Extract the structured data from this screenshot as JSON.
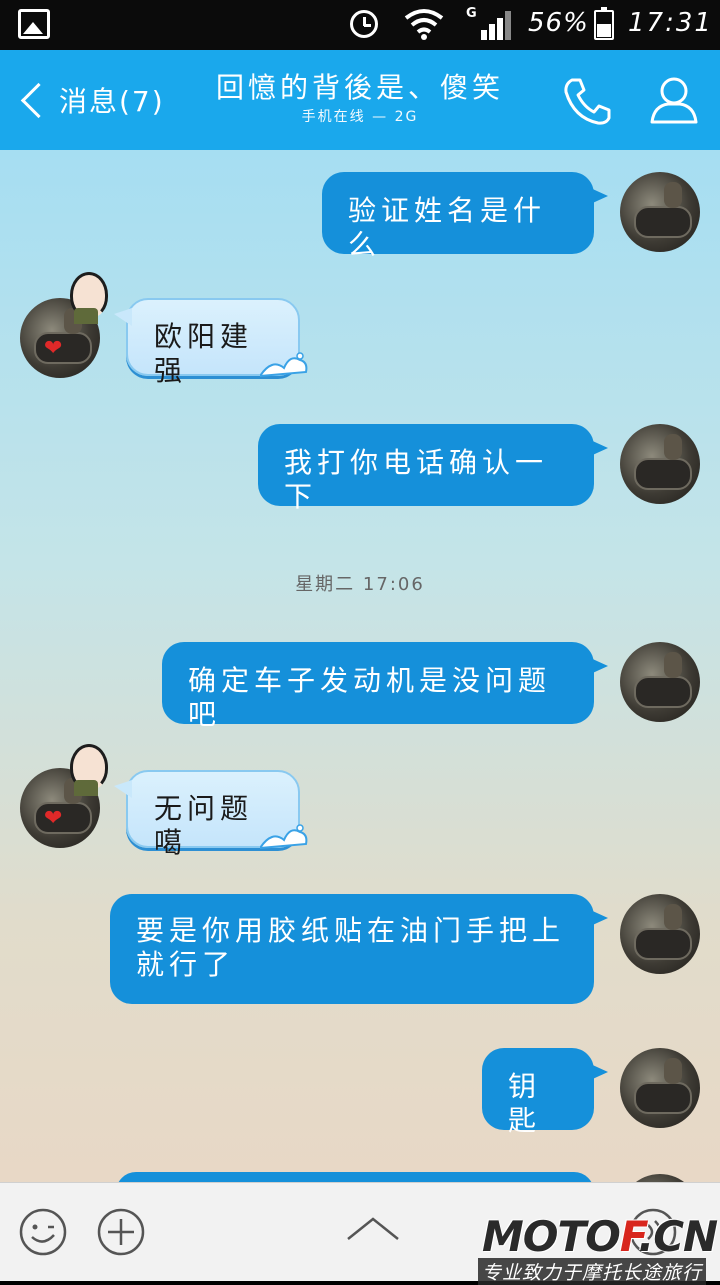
{
  "status_bar": {
    "network": "G",
    "battery_percent": "56%",
    "battery_level": 0.56,
    "time": "17:31"
  },
  "header": {
    "back_label": "消息(7)",
    "contact_name": "回憶的背後是、傻笑",
    "contact_status": "手机在线 — 2G"
  },
  "messages": [
    {
      "side": "me",
      "text": "验证姓名是什么"
    },
    {
      "side": "them",
      "text": "欧阳建强"
    },
    {
      "side": "me",
      "text": "我打你电话确认一下"
    },
    {
      "side": "me",
      "text": "确定车子发动机是没问题吧"
    },
    {
      "side": "them",
      "text": "无问题噶"
    },
    {
      "side": "me",
      "text": "要是你用胶纸贴在油门手把上就行了"
    },
    {
      "side": "me",
      "text": "钥匙"
    }
  ],
  "timestamp": "星期二 17:06",
  "watermark": {
    "logo_left": "MOTO",
    "logo_red": "F",
    "logo_right": ".CN",
    "tagline": "专业致力于摩托长途旅行"
  },
  "colors": {
    "header_bg": "#1aa8ec",
    "my_bubble": "#1590da",
    "their_bubble": "#c5e5fb"
  }
}
